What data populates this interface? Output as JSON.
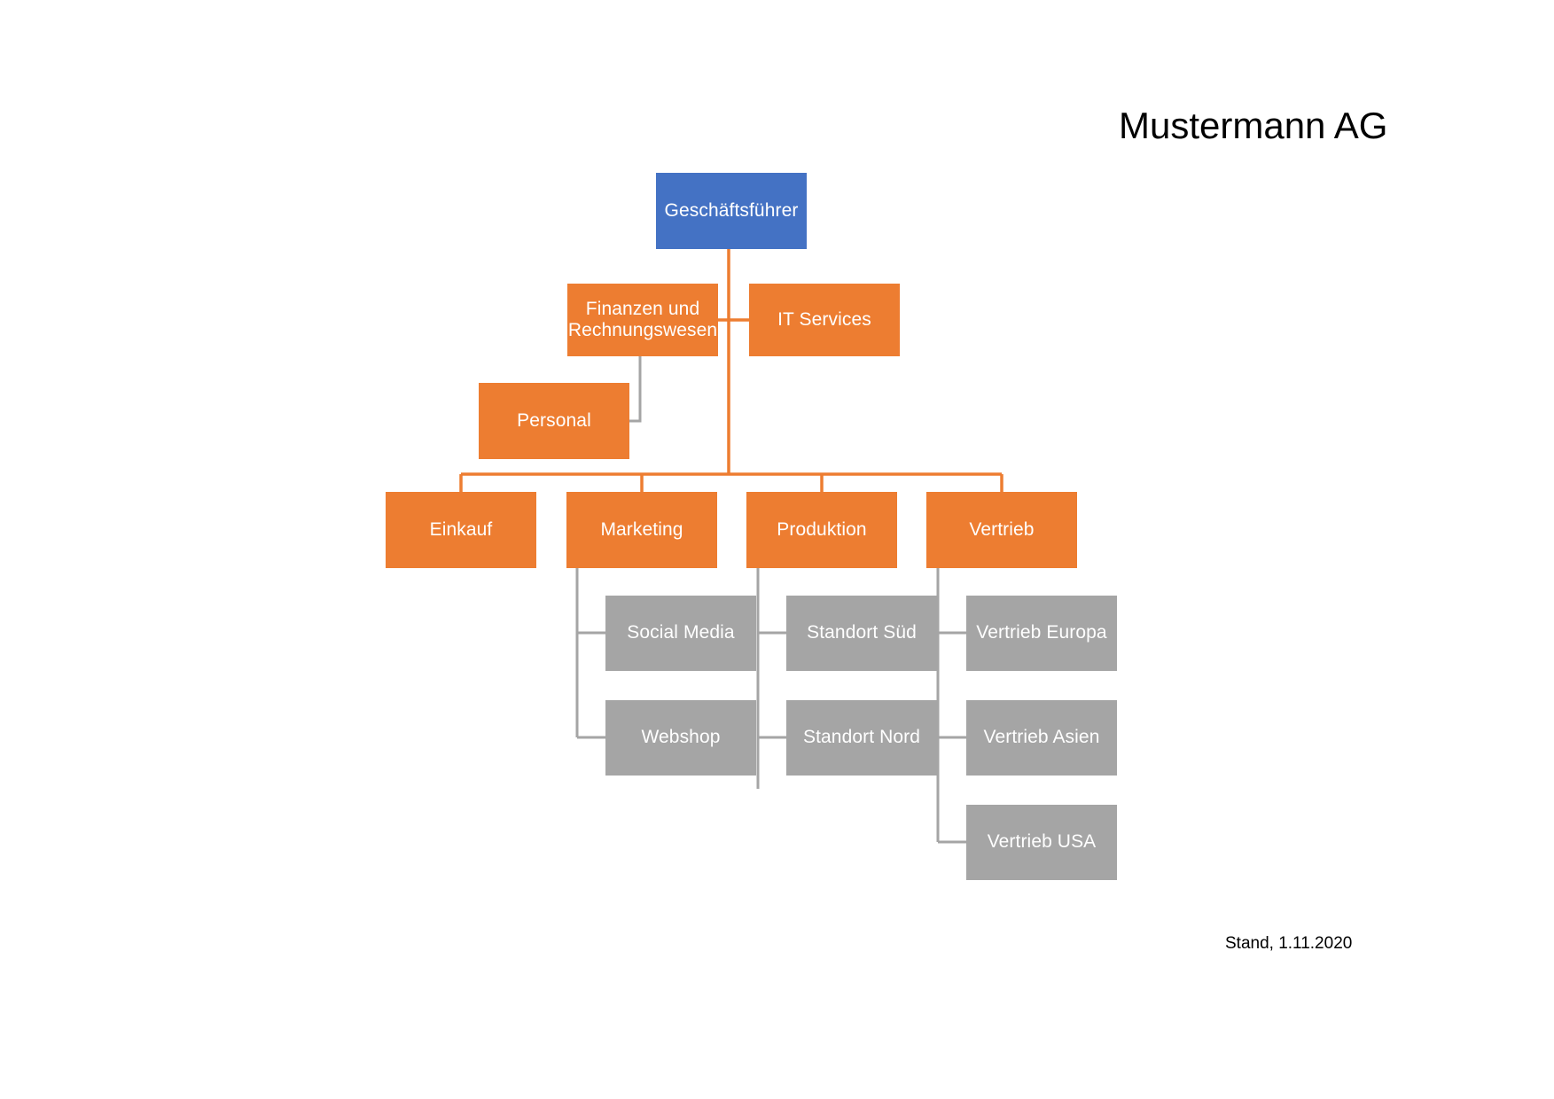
{
  "document": {
    "title": "Mustermann AG",
    "footnote": "Stand, 1.11.2020",
    "background_color": "#FFFFFF"
  },
  "palette": {
    "executive": "#4472C4",
    "department": "#ED7D31",
    "subunit": "#A5A5A5",
    "text_on_box": "#FFFFFF",
    "text": "#000000",
    "connector_orange": "#ED7D31",
    "connector_gray": "#A5A5A5"
  },
  "org_chart": {
    "type": "org-chart",
    "root": {
      "id": "geschaeftsfuehrer",
      "label": "Geschäftsführer",
      "level": 0,
      "color_role": "executive"
    },
    "staff_units": [
      {
        "id": "finanzen",
        "label": "Finanzen und Rechnungswesen",
        "level": 1,
        "color_role": "department",
        "parent": "geschaeftsfuehrer"
      },
      {
        "id": "it-services",
        "label": "IT Services",
        "level": 1,
        "color_role": "department",
        "parent": "geschaeftsfuehrer"
      },
      {
        "id": "personal",
        "label": "Personal",
        "level": 2,
        "color_role": "department",
        "parent": "finanzen"
      }
    ],
    "departments": [
      {
        "id": "einkauf",
        "label": "Einkauf",
        "level": 1,
        "color_role": "department",
        "parent": "geschaeftsfuehrer",
        "children": []
      },
      {
        "id": "marketing",
        "label": "Marketing",
        "level": 1,
        "color_role": "department",
        "parent": "geschaeftsfuehrer",
        "children": [
          {
            "id": "social-media",
            "label": "Social Media",
            "level": 2,
            "color_role": "subunit"
          },
          {
            "id": "webshop",
            "label": "Webshop",
            "level": 2,
            "color_role": "subunit"
          }
        ]
      },
      {
        "id": "produktion",
        "label": "Produktion",
        "level": 1,
        "color_role": "department",
        "parent": "geschaeftsfuehrer",
        "children": [
          {
            "id": "standort-sued",
            "label": "Standort Süd",
            "level": 2,
            "color_role": "subunit"
          },
          {
            "id": "standort-nord",
            "label": "Standort Nord",
            "level": 2,
            "color_role": "subunit"
          }
        ]
      },
      {
        "id": "vertrieb",
        "label": "Vertrieb",
        "level": 1,
        "color_role": "department",
        "parent": "geschaeftsfuehrer",
        "children": [
          {
            "id": "vertrieb-europa",
            "label": "Vertrieb Europa",
            "level": 2,
            "color_role": "subunit"
          },
          {
            "id": "vertrieb-asien",
            "label": "Vertrieb Asien",
            "level": 2,
            "color_role": "subunit"
          },
          {
            "id": "vertrieb-usa",
            "label": "Vertrieb USA",
            "level": 2,
            "color_role": "subunit"
          }
        ]
      }
    ]
  }
}
